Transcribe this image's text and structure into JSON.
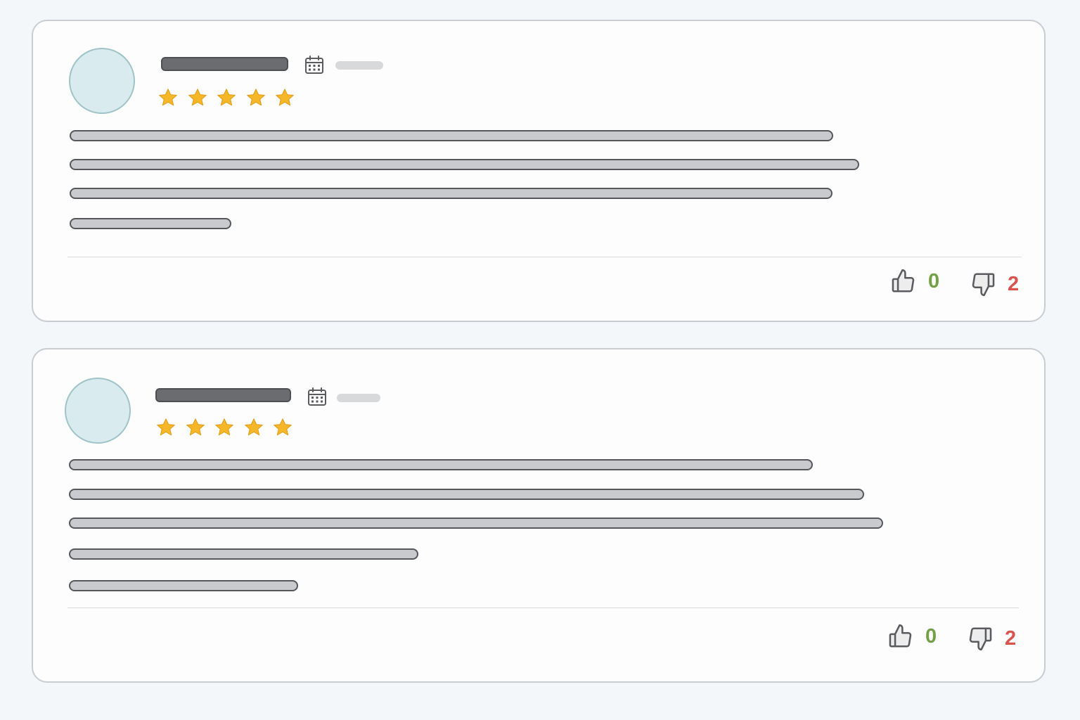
{
  "reviews": [
    {
      "rating": 5,
      "stars_icon": "star-icon",
      "star_color": "#f5b728",
      "likes": "0",
      "dislikes": "2"
    },
    {
      "rating": 5,
      "stars_icon": "star-icon",
      "star_color": "#f5b728",
      "likes": "0",
      "dislikes": "2"
    }
  ],
  "icons": {
    "calendar": "calendar-icon",
    "like": "thumbs-up-icon",
    "dislike": "thumbs-down-icon"
  },
  "colors": {
    "likes_count": "#72a044",
    "dislikes_count": "#d9534f",
    "avatar_fill": "#d9ebef",
    "placeholder_text": "#c9cacd"
  }
}
